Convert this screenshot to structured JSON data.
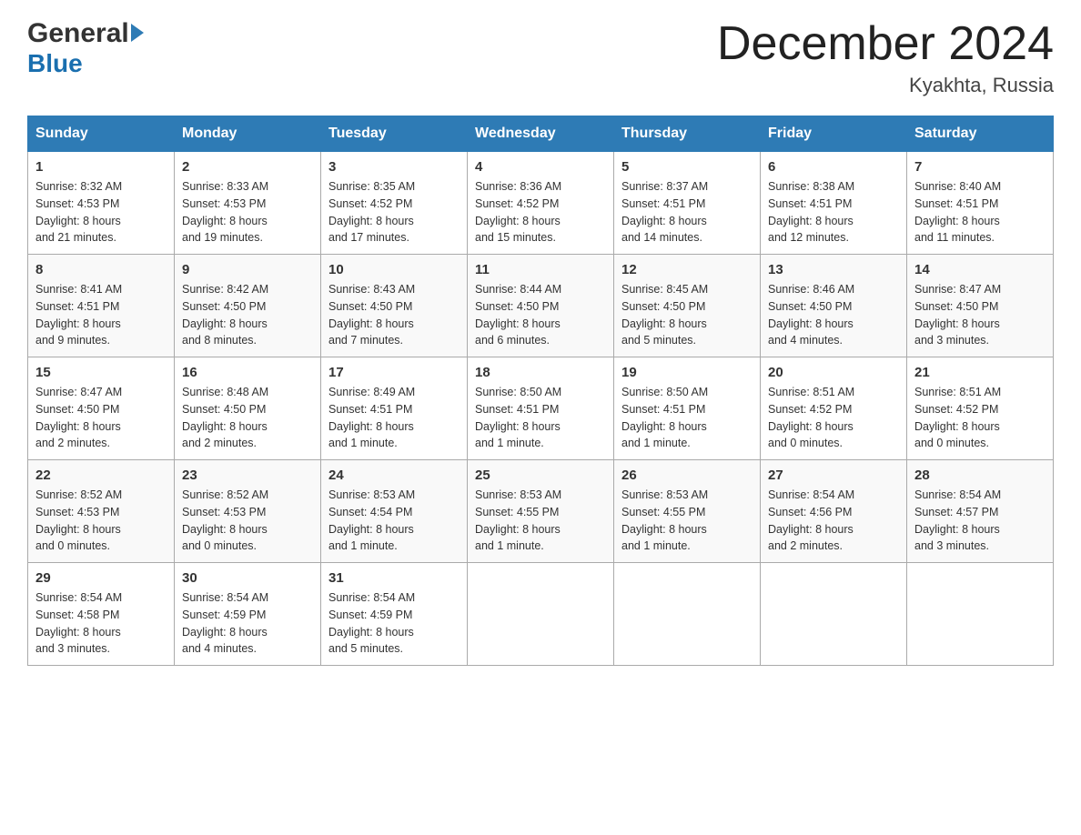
{
  "header": {
    "logo_line1": "General",
    "logo_line2": "Blue",
    "month_title": "December 2024",
    "location": "Kyakhta, Russia"
  },
  "weekdays": [
    "Sunday",
    "Monday",
    "Tuesday",
    "Wednesday",
    "Thursday",
    "Friday",
    "Saturday"
  ],
  "weeks": [
    [
      {
        "day": "1",
        "sunrise": "8:32 AM",
        "sunset": "4:53 PM",
        "daylight": "8 hours and 21 minutes."
      },
      {
        "day": "2",
        "sunrise": "8:33 AM",
        "sunset": "4:53 PM",
        "daylight": "8 hours and 19 minutes."
      },
      {
        "day": "3",
        "sunrise": "8:35 AM",
        "sunset": "4:52 PM",
        "daylight": "8 hours and 17 minutes."
      },
      {
        "day": "4",
        "sunrise": "8:36 AM",
        "sunset": "4:52 PM",
        "daylight": "8 hours and 15 minutes."
      },
      {
        "day": "5",
        "sunrise": "8:37 AM",
        "sunset": "4:51 PM",
        "daylight": "8 hours and 14 minutes."
      },
      {
        "day": "6",
        "sunrise": "8:38 AM",
        "sunset": "4:51 PM",
        "daylight": "8 hours and 12 minutes."
      },
      {
        "day": "7",
        "sunrise": "8:40 AM",
        "sunset": "4:51 PM",
        "daylight": "8 hours and 11 minutes."
      }
    ],
    [
      {
        "day": "8",
        "sunrise": "8:41 AM",
        "sunset": "4:51 PM",
        "daylight": "8 hours and 9 minutes."
      },
      {
        "day": "9",
        "sunrise": "8:42 AM",
        "sunset": "4:50 PM",
        "daylight": "8 hours and 8 minutes."
      },
      {
        "day": "10",
        "sunrise": "8:43 AM",
        "sunset": "4:50 PM",
        "daylight": "8 hours and 7 minutes."
      },
      {
        "day": "11",
        "sunrise": "8:44 AM",
        "sunset": "4:50 PM",
        "daylight": "8 hours and 6 minutes."
      },
      {
        "day": "12",
        "sunrise": "8:45 AM",
        "sunset": "4:50 PM",
        "daylight": "8 hours and 5 minutes."
      },
      {
        "day": "13",
        "sunrise": "8:46 AM",
        "sunset": "4:50 PM",
        "daylight": "8 hours and 4 minutes."
      },
      {
        "day": "14",
        "sunrise": "8:47 AM",
        "sunset": "4:50 PM",
        "daylight": "8 hours and 3 minutes."
      }
    ],
    [
      {
        "day": "15",
        "sunrise": "8:47 AM",
        "sunset": "4:50 PM",
        "daylight": "8 hours and 2 minutes."
      },
      {
        "day": "16",
        "sunrise": "8:48 AM",
        "sunset": "4:50 PM",
        "daylight": "8 hours and 2 minutes."
      },
      {
        "day": "17",
        "sunrise": "8:49 AM",
        "sunset": "4:51 PM",
        "daylight": "8 hours and 1 minute."
      },
      {
        "day": "18",
        "sunrise": "8:50 AM",
        "sunset": "4:51 PM",
        "daylight": "8 hours and 1 minute."
      },
      {
        "day": "19",
        "sunrise": "8:50 AM",
        "sunset": "4:51 PM",
        "daylight": "8 hours and 1 minute."
      },
      {
        "day": "20",
        "sunrise": "8:51 AM",
        "sunset": "4:52 PM",
        "daylight": "8 hours and 0 minutes."
      },
      {
        "day": "21",
        "sunrise": "8:51 AM",
        "sunset": "4:52 PM",
        "daylight": "8 hours and 0 minutes."
      }
    ],
    [
      {
        "day": "22",
        "sunrise": "8:52 AM",
        "sunset": "4:53 PM",
        "daylight": "8 hours and 0 minutes."
      },
      {
        "day": "23",
        "sunrise": "8:52 AM",
        "sunset": "4:53 PM",
        "daylight": "8 hours and 0 minutes."
      },
      {
        "day": "24",
        "sunrise": "8:53 AM",
        "sunset": "4:54 PM",
        "daylight": "8 hours and 1 minute."
      },
      {
        "day": "25",
        "sunrise": "8:53 AM",
        "sunset": "4:55 PM",
        "daylight": "8 hours and 1 minute."
      },
      {
        "day": "26",
        "sunrise": "8:53 AM",
        "sunset": "4:55 PM",
        "daylight": "8 hours and 1 minute."
      },
      {
        "day": "27",
        "sunrise": "8:54 AM",
        "sunset": "4:56 PM",
        "daylight": "8 hours and 2 minutes."
      },
      {
        "day": "28",
        "sunrise": "8:54 AM",
        "sunset": "4:57 PM",
        "daylight": "8 hours and 3 minutes."
      }
    ],
    [
      {
        "day": "29",
        "sunrise": "8:54 AM",
        "sunset": "4:58 PM",
        "daylight": "8 hours and 3 minutes."
      },
      {
        "day": "30",
        "sunrise": "8:54 AM",
        "sunset": "4:59 PM",
        "daylight": "8 hours and 4 minutes."
      },
      {
        "day": "31",
        "sunrise": "8:54 AM",
        "sunset": "4:59 PM",
        "daylight": "8 hours and 5 minutes."
      },
      null,
      null,
      null,
      null
    ]
  ],
  "labels": {
    "sunrise": "Sunrise:",
    "sunset": "Sunset:",
    "daylight": "Daylight:"
  }
}
